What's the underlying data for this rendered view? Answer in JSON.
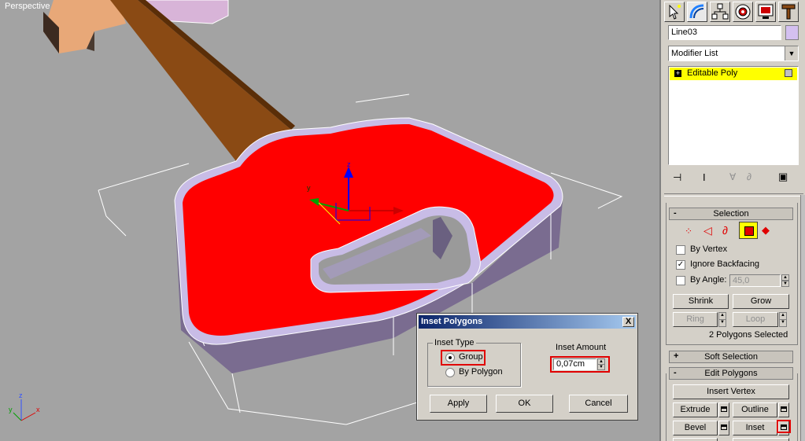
{
  "viewport": {
    "label": "Perspective"
  },
  "axis": {
    "x": "x",
    "y": "y",
    "z": "z"
  },
  "gizmo": {
    "x": "x",
    "y": "y",
    "z": "z"
  },
  "command_panel": {
    "tabs": [
      {
        "name": "create-tab"
      },
      {
        "name": "modify-tab"
      },
      {
        "name": "hierarchy-tab"
      },
      {
        "name": "motion-tab"
      },
      {
        "name": "display-tab"
      },
      {
        "name": "utilities-tab"
      }
    ],
    "object_name": "Line03",
    "object_color": "#d4c0f0",
    "modifier_list": "Modifier List",
    "stack": [
      {
        "label": "Editable Poly",
        "expand": "+"
      }
    ],
    "selection": {
      "title": "Selection",
      "collapse": "-",
      "by_vertex": "By Vertex",
      "ignore_backfacing": "Ignore Backfacing",
      "ignore_backfacing_checked": "✓",
      "by_angle": "By Angle:",
      "angle_value": "45,0",
      "shrink": "Shrink",
      "grow": "Grow",
      "ring": "Ring",
      "loop": "Loop",
      "status": "2 Polygons Selected"
    },
    "soft_selection": {
      "title": "Soft Selection",
      "expand": "+"
    },
    "edit_polygons": {
      "title": "Edit Polygons",
      "collapse": "-",
      "insert_vertex": "Insert Vertex",
      "extrude": "Extrude",
      "outline": "Outline",
      "bevel": "Bevel",
      "inset": "Inset"
    }
  },
  "dialog": {
    "title": "Inset Polygons",
    "close": "X",
    "inset_type_label": "Inset Type",
    "option_group": "Group",
    "option_by_polygon": "By Polygon",
    "selected_option": "Group",
    "inset_amount_label": "Inset Amount",
    "inset_amount_value": "0,07cm",
    "apply": "Apply",
    "ok": "OK",
    "cancel": "Cancel"
  },
  "colors": {
    "viewport_bg": "#a3a3a3",
    "selected_face": "#ff0000",
    "rim": "#c8bce6",
    "side": "#7a6c90",
    "handle": "#8a4a14",
    "stack_highlight": "#ffff00",
    "red_outline": "#e00000"
  }
}
